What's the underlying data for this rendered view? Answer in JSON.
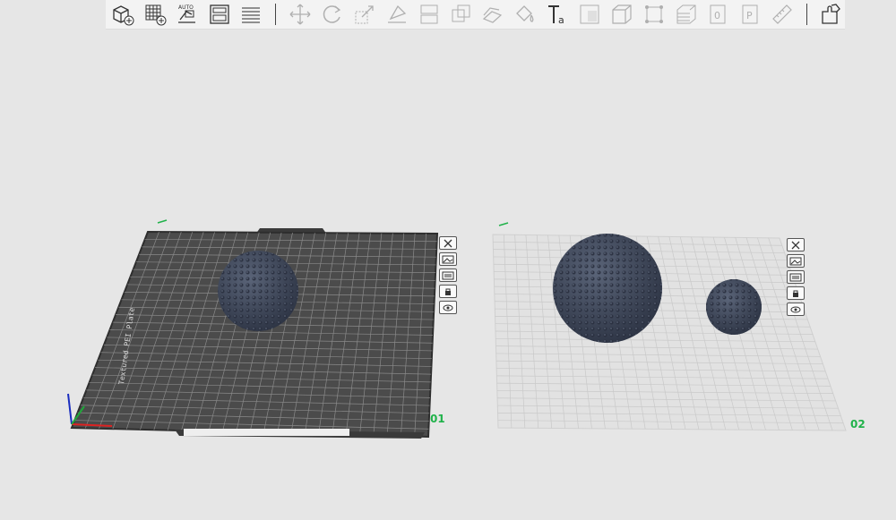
{
  "toolbar": {
    "groups": [
      [
        "add-object",
        "add-plate",
        "auto-arrange",
        "arrange-plates",
        "layers"
      ],
      [
        "move",
        "rotate",
        "scale",
        "place-on-face",
        "split",
        "boolean",
        "cut",
        "paint",
        "text",
        "emboss",
        "solid",
        "mesh-fit",
        "variable-layer",
        "p-tool",
        "measure"
      ],
      [
        "assembly"
      ]
    ]
  },
  "plates": [
    {
      "id": "plate-1",
      "label": "01",
      "style": "textured-dark",
      "active": true
    },
    {
      "id": "plate-2",
      "label": "02",
      "style": "smooth-light",
      "active": false
    }
  ],
  "plate_tool_icons": [
    "close-icon",
    "image-icon",
    "layout-icon",
    "lock-icon",
    "eye-icon"
  ],
  "plate1_edge_text": "Textured PEI Plate",
  "colors": {
    "accent": "#20b24a",
    "object": "#3b4252",
    "dark_plate": "#4b4b4b"
  }
}
